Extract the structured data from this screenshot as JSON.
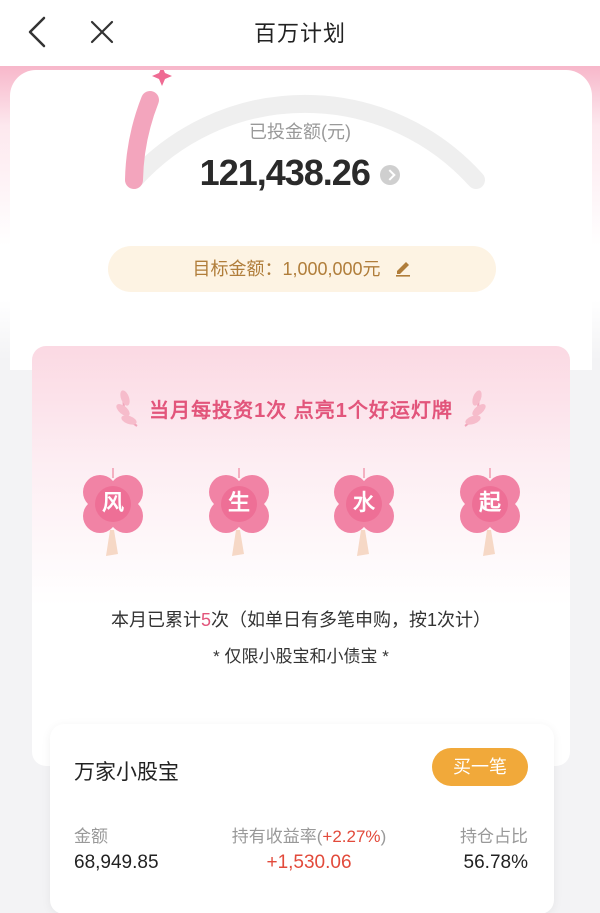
{
  "nav": {
    "title": "百万计划"
  },
  "summary": {
    "invested_label": "已投金额(元)",
    "invested_amount": "121,438.26",
    "target_text": "目标金额：1,000,000元",
    "progress_fraction": 0.12
  },
  "lucky": {
    "title": "当月每投资1次 点亮1个好运灯牌",
    "cards": [
      "风",
      "生",
      "水",
      "起"
    ],
    "count_prefix": "本月已累计",
    "count_num": "5",
    "count_suffix": "次（如单日有多笔申购，按1次计）",
    "note": "* 仅限小股宝和小债宝 *"
  },
  "fund": {
    "name": "万家小股宝",
    "buy_label": "买一笔",
    "amount_label": "金额",
    "amount_value": "68,949.85",
    "yield_label_prefix": "持有收益率(",
    "yield_rate": "+2.27%",
    "yield_label_suffix": ")",
    "yield_value": "+1,530.06",
    "ratio_label": "持仓占比",
    "ratio_value": "56.78%"
  },
  "colors": {
    "accent_pink": "#e2557b",
    "gold": "#f1a93a",
    "positive": "#e24a3b"
  }
}
